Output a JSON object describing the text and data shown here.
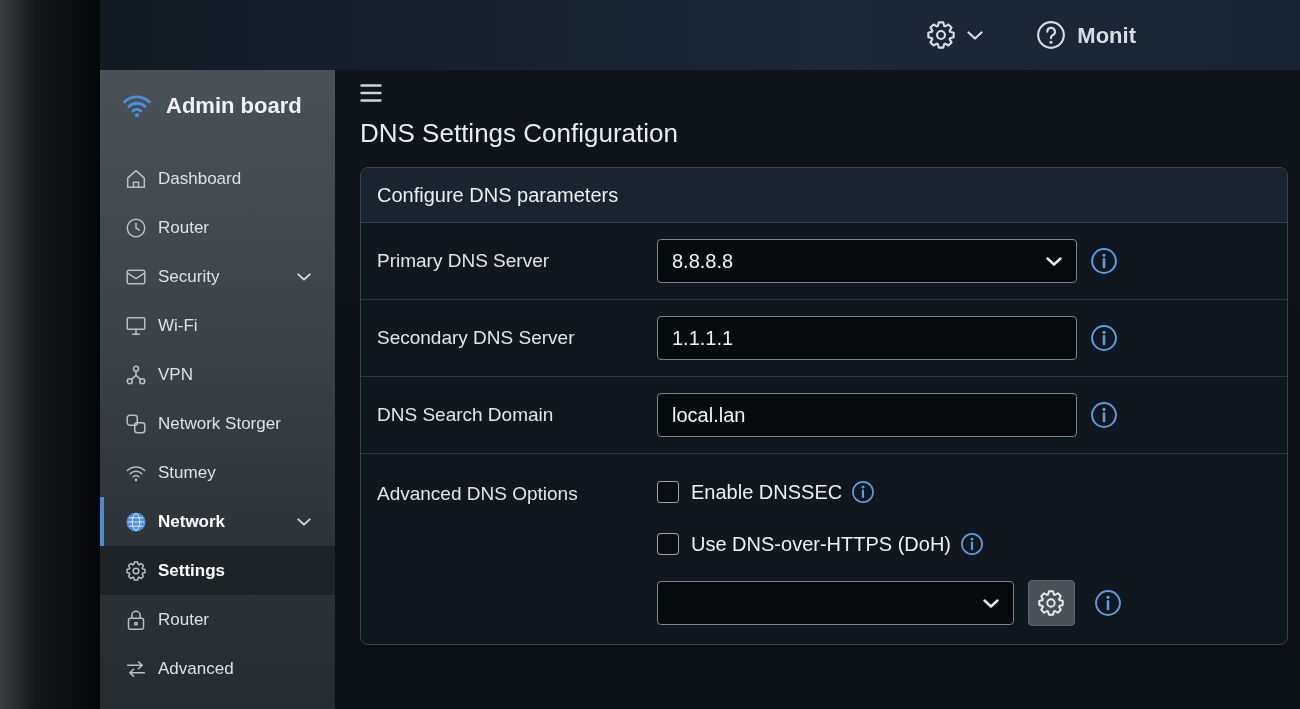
{
  "topbar": {
    "help_label": "Monit"
  },
  "sidebar": {
    "brand": "Admin board",
    "items": [
      {
        "label": "Dashboard",
        "selected": false,
        "submenu": false
      },
      {
        "label": "Router",
        "selected": false,
        "submenu": false
      },
      {
        "label": "Security",
        "selected": false,
        "submenu": true
      },
      {
        "label": "Wi-Fi",
        "selected": false,
        "submenu": false
      },
      {
        "label": "VPN",
        "selected": false,
        "submenu": false
      },
      {
        "label": "Network Storger",
        "selected": false,
        "submenu": false
      },
      {
        "label": "Stumey",
        "selected": false,
        "submenu": false
      },
      {
        "label": "Network",
        "selected": true,
        "submenu": true,
        "children": [
          {
            "label": "Settings",
            "selected": true
          },
          {
            "label": "Router",
            "selected": false
          },
          {
            "label": "Advanced",
            "selected": false
          }
        ]
      }
    ]
  },
  "page": {
    "title": "DNS Settings Configuration"
  },
  "card": {
    "title": "Configure DNS parameters",
    "rows": [
      {
        "kind": "select",
        "label": "Primary DNS Server",
        "value": "8.8.8.8"
      },
      {
        "kind": "input",
        "label": "Secondary DNS Server",
        "value": "1.1.1.1"
      },
      {
        "kind": "input",
        "label": "DNS Search Domain",
        "value": "local.lan"
      },
      {
        "kind": "options",
        "label": "Advanced DNS Options",
        "options": [
          {
            "label": "Enable DNSSEC",
            "checked": false
          },
          {
            "label": "Use DNS-over-HTTPS (DoH)",
            "checked": false
          }
        ]
      }
    ]
  }
}
